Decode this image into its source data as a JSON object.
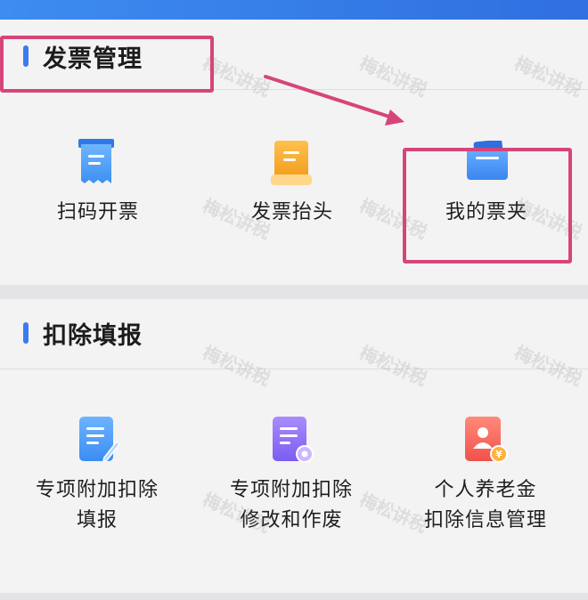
{
  "invoice_section": {
    "title": "发票管理",
    "items": [
      {
        "label": "扫码开票",
        "icon": "scan-invoice-icon"
      },
      {
        "label": "发票抬头",
        "icon": "invoice-header-icon"
      },
      {
        "label": "我的票夹",
        "icon": "invoice-folder-icon"
      }
    ]
  },
  "deduction_section": {
    "title": "扣除填报",
    "items": [
      {
        "line1": "专项附加扣除",
        "line2": "填报",
        "icon": "edit-document-icon"
      },
      {
        "line1": "专项附加扣除",
        "line2": "修改和作废",
        "icon": "document-settings-icon"
      },
      {
        "line1": "个人养老金",
        "line2": "扣除信息管理",
        "icon": "pension-card-icon"
      }
    ]
  },
  "watermark": "梅松讲税",
  "colors": {
    "accent": "#3b7bf0",
    "highlight": "#d6457a",
    "background": "#f3f3f4"
  }
}
